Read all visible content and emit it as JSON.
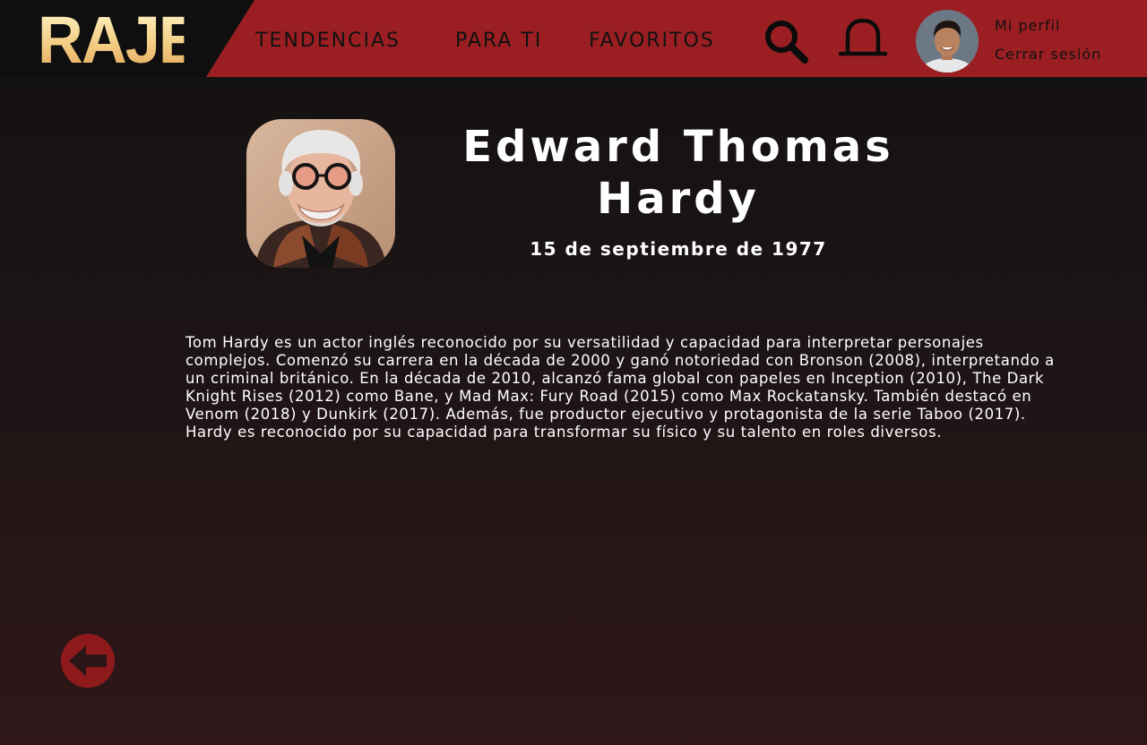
{
  "header": {
    "logo_text": "RAJE",
    "nav": {
      "trending": "TENDENCIAS",
      "for_you": "PARA TI",
      "favorites": "FAVORITOS"
    },
    "icons": {
      "search": "search-icon",
      "notifications": "bell-icon"
    },
    "user": {
      "profile_label": "Mi perfil",
      "logout_label": "Cerrar sesión"
    }
  },
  "actor": {
    "name": "Edward Thomas Hardy",
    "birth_date": "15 de septiembre de 1977",
    "bio": "Tom Hardy es un actor inglés reconocido por su versatilidad y capacidad para interpretar personajes complejos. Comenzó su carrera en la década de 2000 y ganó notoriedad con Bronson (2008), interpretando a un criminal británico. En la década de 2010, alcanzó fama global con papeles en Inception (2010), The Dark Knight Rises (2012) como Bane, y Mad Max: Fury Road (2015) como Max Rockatansky. También destacó en Venom (2018) y Dunkirk (2017). Además, fue productor ejecutivo y protagonista de la serie Taboo (2017). Hardy es reconocido por su capacidad para transformar su físico y su talento en roles diversos."
  },
  "controls": {
    "back_icon": "arrow-left-circle-icon"
  },
  "colors": {
    "header_bg": "#9b1f22",
    "logo_bg": "#0f0f0f",
    "logo_gold": "#f3cd84",
    "back_button": "#8e1a1c",
    "page_bg_top": "#131111",
    "page_bg_bottom": "#2f1718"
  }
}
